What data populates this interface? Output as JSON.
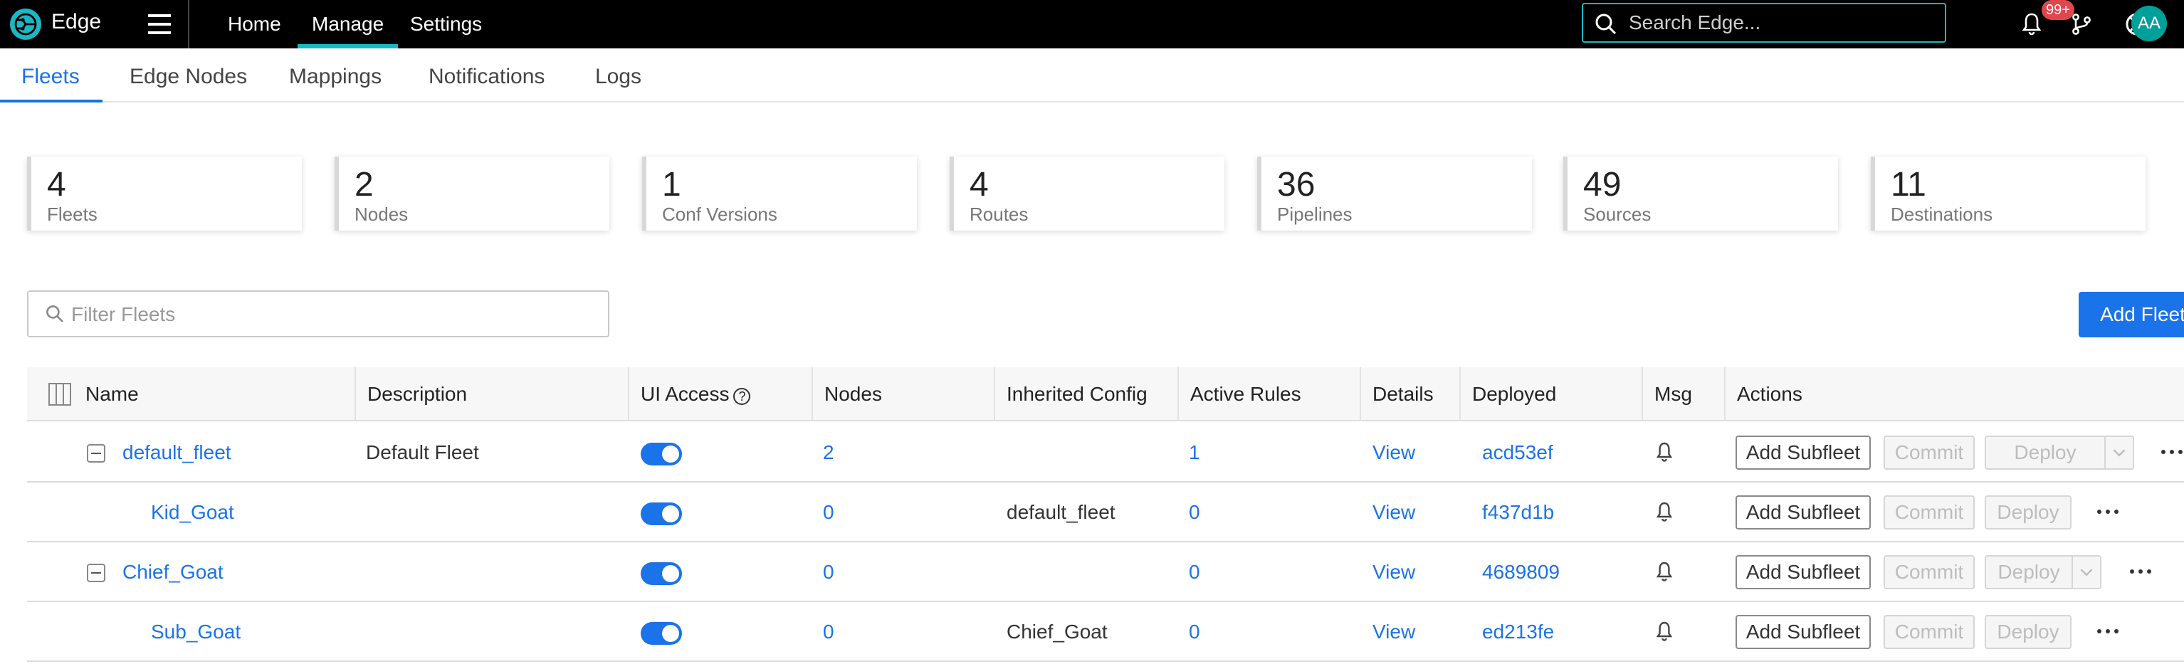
{
  "brand": "Edge",
  "topnav": [
    "Home",
    "Manage",
    "Settings"
  ],
  "search": {
    "placeholder": "Search Edge..."
  },
  "badge": "99+",
  "avatar": "AA",
  "subnav": [
    "Fleets",
    "Edge Nodes",
    "Mappings",
    "Notifications",
    "Logs"
  ],
  "stats": [
    {
      "value": "4",
      "label": "Fleets"
    },
    {
      "value": "2",
      "label": "Nodes"
    },
    {
      "value": "1",
      "label": "Conf Versions"
    },
    {
      "value": "4",
      "label": "Routes"
    },
    {
      "value": "36",
      "label": "Pipelines"
    },
    {
      "value": "49",
      "label": "Sources"
    },
    {
      "value": "11",
      "label": "Destinations"
    }
  ],
  "filter": {
    "placeholder": "Filter Fleets"
  },
  "add_fleet": "Add Fleet",
  "columns": [
    "Name",
    "Description",
    "UI Access",
    "Nodes",
    "Inherited Config",
    "Active Rules",
    "Details",
    "Deployed",
    "Msg",
    "Actions"
  ],
  "actions": {
    "add_subfleet": "Add Subfleet",
    "commit": "Commit",
    "deploy": "Deploy"
  },
  "rows": [
    {
      "name": "default_fleet",
      "description": "Default Fleet",
      "ui_access": true,
      "nodes": "2",
      "inherited": "",
      "active_rules": "1",
      "details": "View",
      "deployed": "acd53ef"
    },
    {
      "name": "Kid_Goat",
      "description": "",
      "ui_access": true,
      "nodes": "0",
      "inherited": "default_fleet",
      "active_rules": "0",
      "details": "View",
      "deployed": "f437d1b"
    },
    {
      "name": "Chief_Goat",
      "description": "",
      "ui_access": true,
      "nodes": "0",
      "inherited": "",
      "active_rules": "0",
      "details": "View",
      "deployed": "4689809"
    },
    {
      "name": "Sub_Goat",
      "description": "",
      "ui_access": true,
      "nodes": "0",
      "inherited": "Chief_Goat",
      "active_rules": "0",
      "details": "View",
      "deployed": "ed213fe"
    }
  ]
}
